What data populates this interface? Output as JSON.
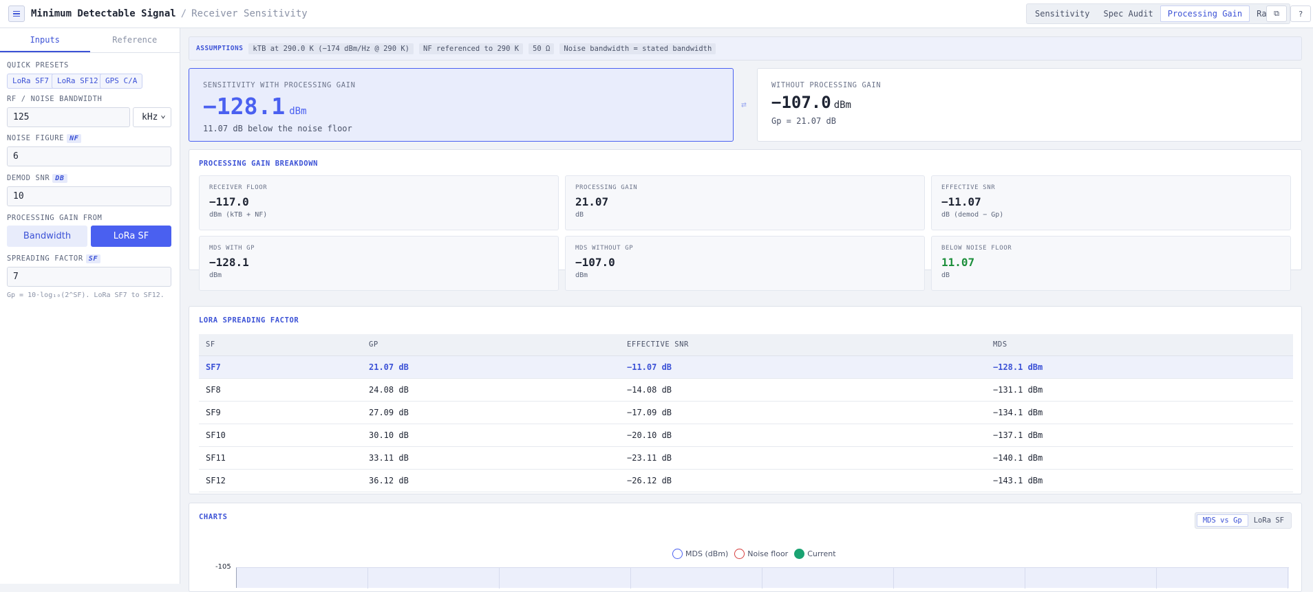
{
  "header": {
    "title": "Minimum Detectable Signal",
    "separator": "/",
    "page": "Receiver Sensitivity",
    "tabs": [
      "Sensitivity",
      "Spec Audit",
      "Processing Gain",
      "Range"
    ],
    "active_tab": "Processing Gain"
  },
  "sidebar": {
    "tabs": [
      "Inputs",
      "Reference"
    ],
    "quick_presets_label": "QUICK PRESETS",
    "presets": [
      "LoRa SF7",
      "LoRa SF12",
      "GPS C/A"
    ],
    "bandwidth_label": "RF / NOISE BANDWIDTH",
    "bandwidth_value": "125",
    "bandwidth_unit": "kHz",
    "nf_label": "NOISE FIGURE",
    "nf_tag": "NF",
    "nf_value": "6",
    "snr_label": "DEMOD SNR",
    "snr_tag": "DB",
    "snr_value": "10",
    "gain_from_label": "PROCESSING GAIN FROM",
    "gain_from_options": [
      "Bandwidth",
      "LoRa SF"
    ],
    "gain_from_selected": "LoRa SF",
    "sf_label": "SPREADING FACTOR",
    "sf_tag": "SF",
    "sf_value": "7",
    "hint": "Gp = 10·log₁₀(2^SF). LoRa SF7 to SF12."
  },
  "assumptions": {
    "label": "ASSUMPTIONS",
    "chips": [
      "kTB at 290.0 K (−174 dBm/Hz @ 290 K)",
      "NF referenced to 290 K",
      "50 Ω",
      "Noise bandwidth = stated bandwidth"
    ]
  },
  "sensitivity_with": {
    "label": "SENSITIVITY WITH PROCESSING GAIN",
    "value": "−128.1",
    "unit": "dBm",
    "sub": "11.07 dB below the noise floor"
  },
  "sensitivity_without": {
    "label": "WITHOUT PROCESSING GAIN",
    "value": "−107.0",
    "unit": "dBm",
    "sub": "Gp = 21.07 dB"
  },
  "breakdown": {
    "title": "PROCESSING GAIN BREAKDOWN",
    "metrics": [
      {
        "label": "RECEIVER FLOOR",
        "value": "−117.0",
        "unit": "dBm (kTB + NF)"
      },
      {
        "label": "PROCESSING GAIN",
        "value": "21.07",
        "unit": "dB"
      },
      {
        "label": "EFFECTIVE SNR",
        "value": "−11.07",
        "unit": "dB (demod − Gp)"
      },
      {
        "label": "MDS WITH GP",
        "value": "−128.1",
        "unit": "dBm"
      },
      {
        "label": "MDS WITHOUT GP",
        "value": "−107.0",
        "unit": "dBm"
      },
      {
        "label": "BELOW NOISE FLOOR",
        "value": "11.07",
        "unit": "dB"
      }
    ]
  },
  "lora_table": {
    "title": "LORA SPREADING FACTOR",
    "columns": [
      "SF",
      "GP",
      "EFFECTIVE SNR",
      "MDS"
    ],
    "rows": [
      [
        "SF7",
        "21.07 dB",
        "−11.07 dB",
        "−128.1 dBm"
      ],
      [
        "SF8",
        "24.08 dB",
        "−14.08 dB",
        "−131.1 dBm"
      ],
      [
        "SF9",
        "27.09 dB",
        "−17.09 dB",
        "−134.1 dBm"
      ],
      [
        "SF10",
        "30.10 dB",
        "−20.10 dB",
        "−137.1 dBm"
      ],
      [
        "SF11",
        "33.11 dB",
        "−23.11 dB",
        "−140.1 dBm"
      ],
      [
        "SF12",
        "36.12 dB",
        "−26.12 dB",
        "−143.1 dBm"
      ]
    ],
    "current_row": 0
  },
  "charts": {
    "title": "CHARTS",
    "toggle": [
      "MDS vs Gp",
      "LoRa SF"
    ],
    "active": "MDS vs Gp",
    "legend": [
      {
        "name": "MDS (dBm)",
        "color": "#4a60f0",
        "style": "ring"
      },
      {
        "name": "Noise floor",
        "color": "#d63b3b",
        "style": "ring"
      },
      {
        "name": "Current",
        "color": "#1aa372",
        "style": "filled"
      }
    ],
    "y_tick": "-105"
  },
  "colors": {
    "accent": "#4a60f0",
    "good": "#1d8f3c"
  }
}
